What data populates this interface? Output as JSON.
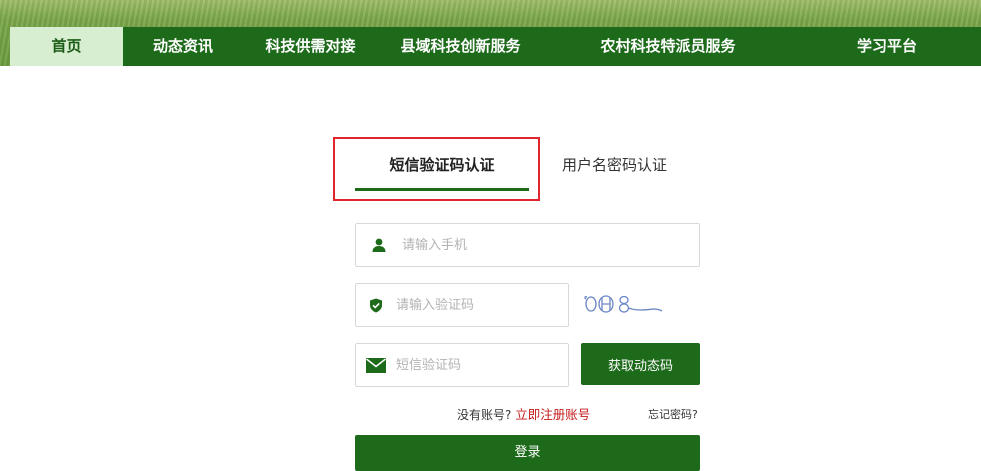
{
  "nav": {
    "items": [
      {
        "label": "首页",
        "active": true
      },
      {
        "label": "动态资讯"
      },
      {
        "label": "科技供需对接"
      },
      {
        "label": "县域科技创新服务"
      },
      {
        "label": "农村科技特派员服务"
      },
      {
        "label": "学习平台"
      }
    ]
  },
  "login": {
    "tabs": {
      "sms": "短信验证码认证",
      "password": "用户名密码认证"
    },
    "phone": {
      "placeholder": "请输入手机",
      "icon": "user-icon"
    },
    "verify": {
      "placeholder": "请输入验证码",
      "icon": "shield-icon"
    },
    "captcha_text": "0H8",
    "sms": {
      "placeholder": "短信验证码",
      "icon": "envelope-icon"
    },
    "get_code_label": "获取动态码",
    "no_account": "没有账号?",
    "register_link": "立即注册账号",
    "forgot": "忘记密码?",
    "submit_label": "登录"
  },
  "colors": {
    "primary": "#1d6a1a",
    "nav_active_bg": "#d7efd0",
    "highlight_border": "#e0252b",
    "link_red": "#c41b1b"
  }
}
